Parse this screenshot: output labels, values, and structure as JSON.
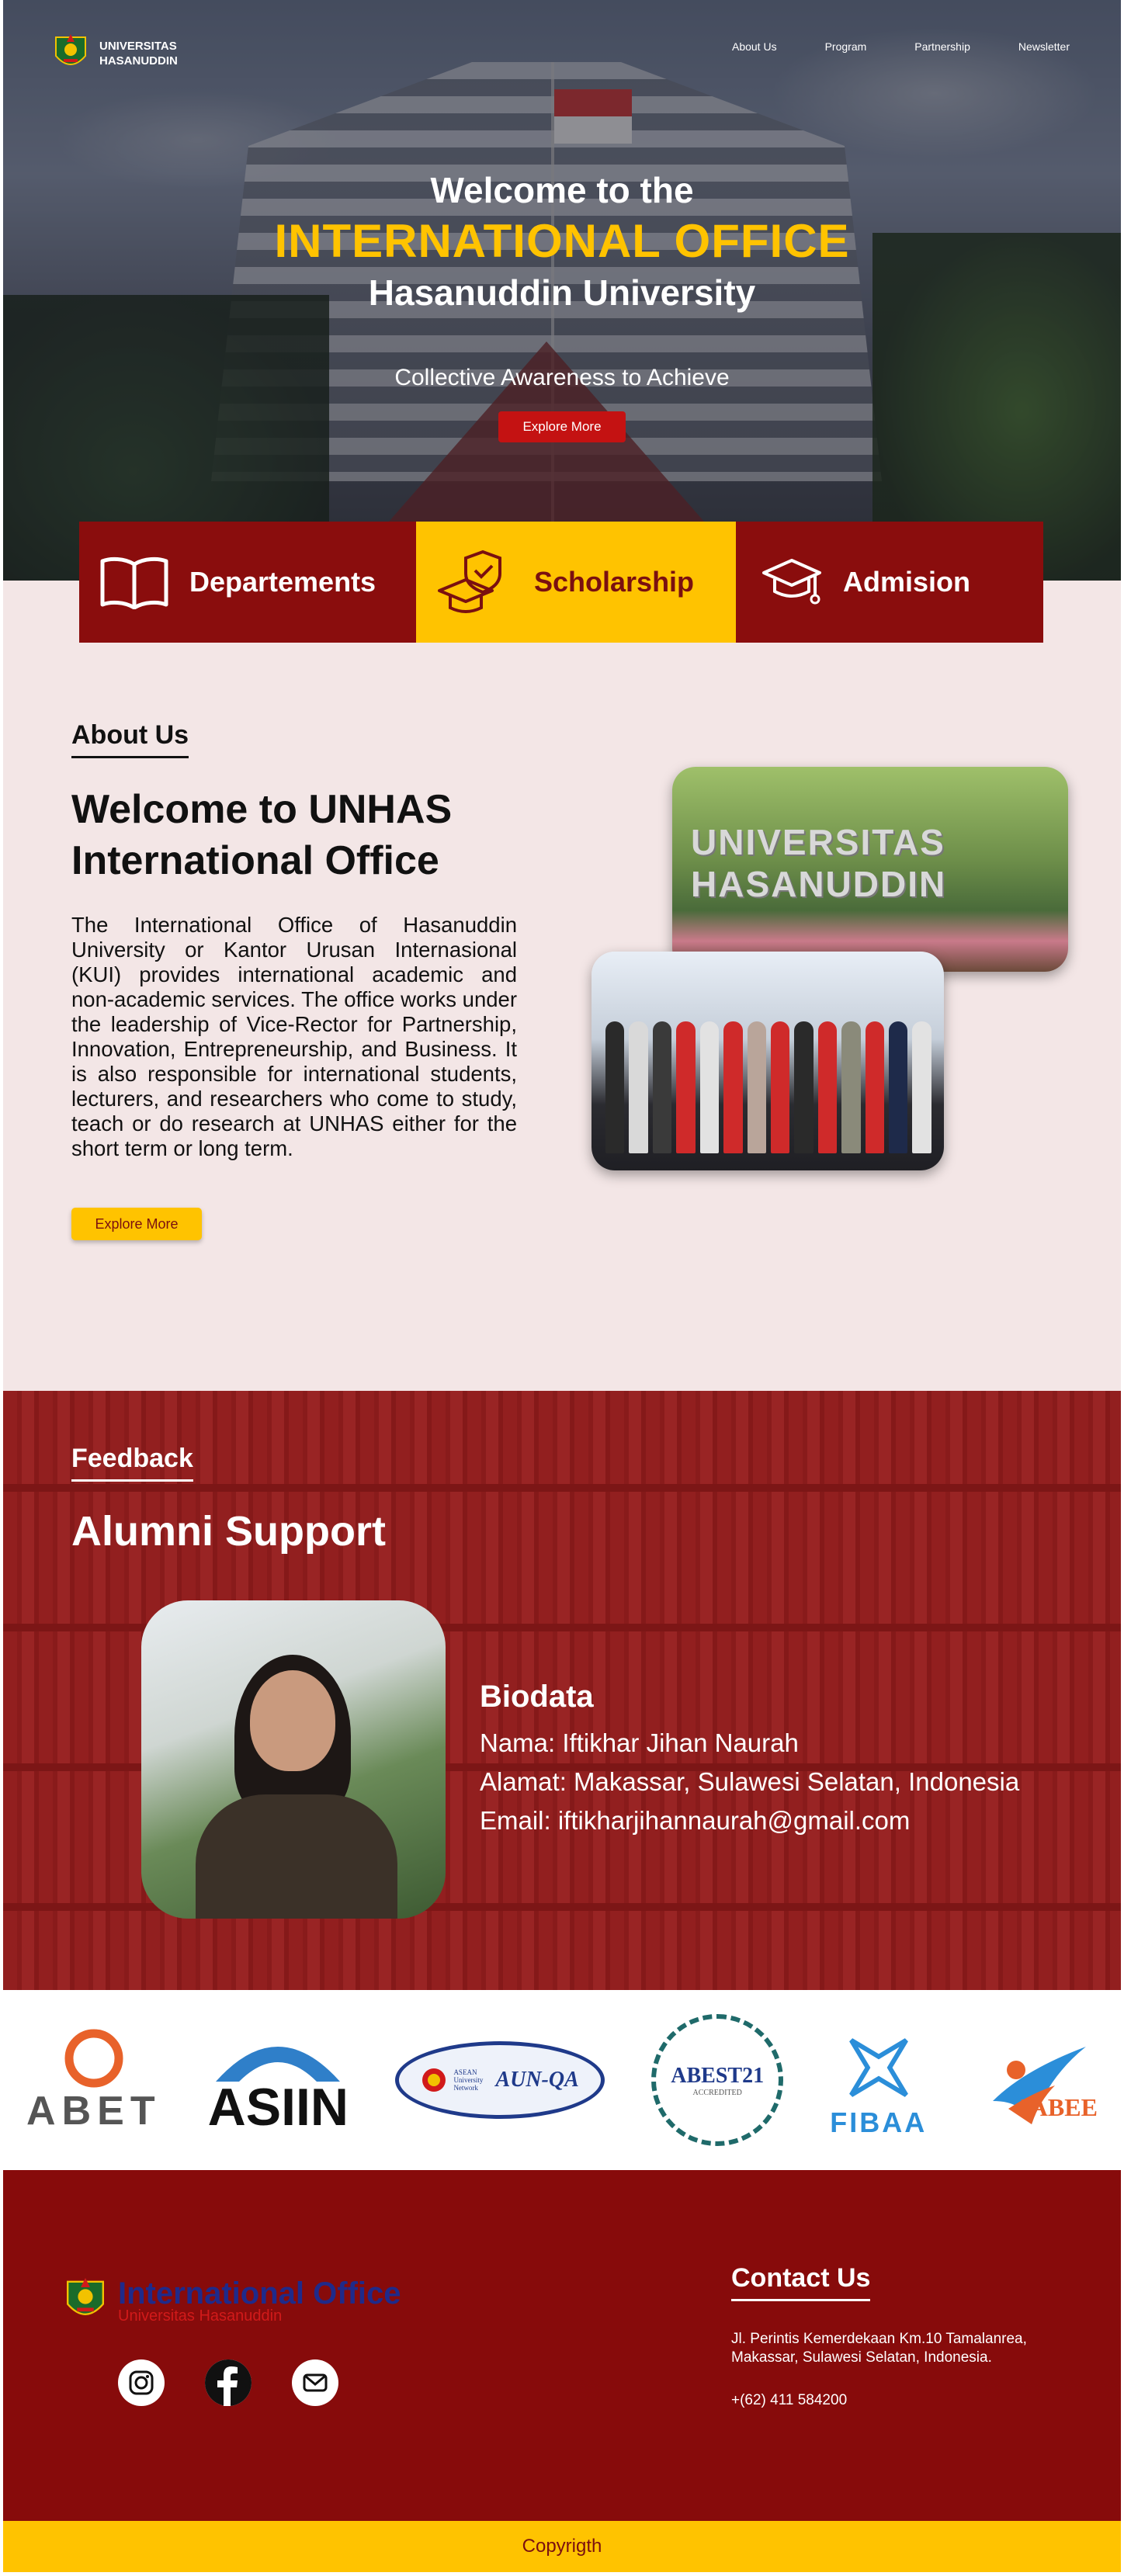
{
  "header": {
    "logo_line1": "UNIVERSITAS",
    "logo_line2": "HASANUDDIN",
    "nav": [
      "About Us",
      "Program",
      "Partnership",
      "Newsletter"
    ]
  },
  "hero": {
    "welcome": "Welcome to the",
    "office": "INTERNATIONAL OFFICE",
    "university": "Hasanuddin University",
    "tagline": "Collective Awareness to Achieve",
    "button": "Explore More"
  },
  "quick_links": [
    {
      "label": "Departements",
      "icon": "book-icon"
    },
    {
      "label": "Scholarship",
      "icon": "graduation-shield-icon"
    },
    {
      "label": "Admision",
      "icon": "graduation-cap-icon"
    }
  ],
  "about": {
    "section_label": "About Us",
    "title_line1": "Welcome to UNHAS",
    "title_line2": "International Office",
    "body": "The International Office of Hasanuddin University or Kantor Urusan Internasional (KUI) provides international academic and non-academic services. The office works under the leadership of Vice-Rector for Partnership, Innovation, Entrepreneurship, and Business. It is also responsible for international students, lecturers, and researchers who come to study, teach or do research at UNHAS either for the short term or long term.",
    "button": "Explore More",
    "photo1_lettering": "UNIVERSITAS HASANUDDIN"
  },
  "feedback": {
    "section_label": "Feedback",
    "title": "Alumni Support",
    "bio_heading": "Biodata",
    "name": "Nama: Iftikhar Jihan Naurah",
    "address": "Alamat: Makassar, Sulawesi Selatan, Indonesia",
    "email": "Email: iftikharjihannaurah@gmail.com"
  },
  "accreditations": [
    "ABET",
    "ASIIN",
    "AUN-QA",
    "ABEST21",
    "FIBAA",
    "IABEE"
  ],
  "accreditation_small": {
    "aun_caption": "ASEAN University Network",
    "abest_caption": "ACCREDITED"
  },
  "footer": {
    "brand_title": "International Office",
    "brand_sub": "Universitas Hasanuddin",
    "social_icons": [
      "instagram-icon",
      "facebook-icon",
      "mail-icon"
    ],
    "contact_label": "Contact Us",
    "address": "Jl. Perintis Kemerdekaan Km.10 Tamalanrea, Makassar, Sulawesi Selatan, Indonesia.",
    "phone": "+(62) 411 584200",
    "copyright": "Copyrigth"
  },
  "colors": {
    "maroon": "#870b0b",
    "gold": "#ffc300",
    "red_button": "#c41212",
    "about_bg": "#f3e6e6",
    "footer_brand_blue": "#1f2a8a"
  }
}
